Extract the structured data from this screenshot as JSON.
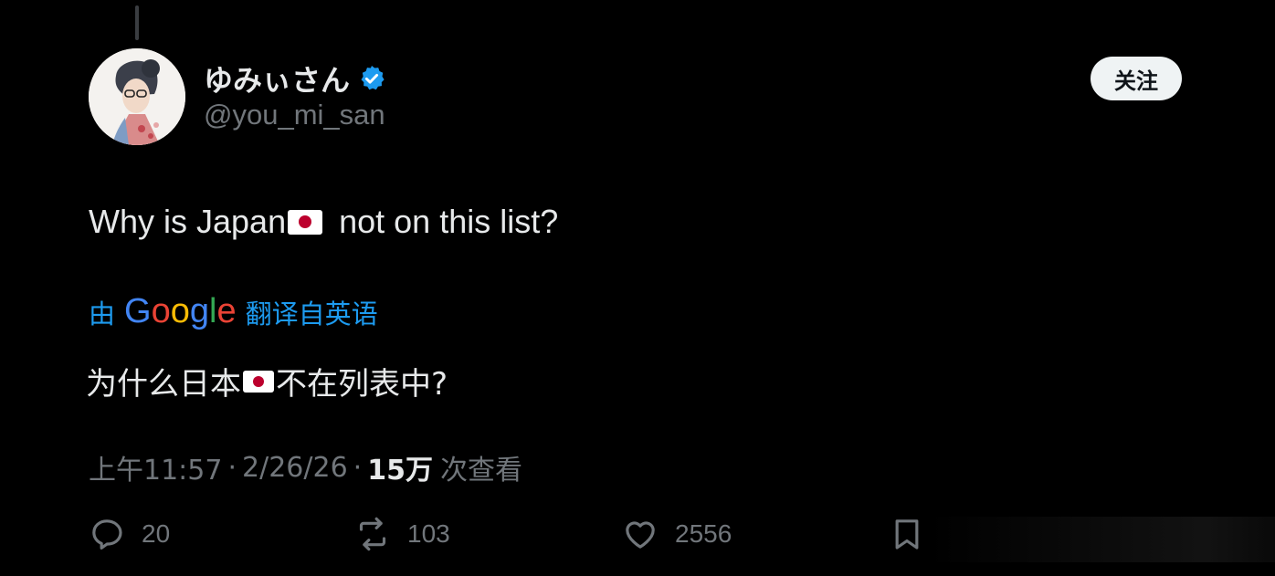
{
  "author": {
    "display_name": "ゆみぃさん",
    "handle": "@you_mi_san",
    "verified": true
  },
  "follow_button": {
    "label": "关注"
  },
  "tweet": {
    "text_before_flag": "Why is Japan",
    "text_after_flag": " not on this list?"
  },
  "translation": {
    "prefix": "由",
    "provider": "Google",
    "suffix": "翻译自英语",
    "text_before_flag": "为什么日本",
    "text_after_flag": "不在列表中?"
  },
  "meta": {
    "time": "上午11:57",
    "separator": "·",
    "date": "2/26/26",
    "views_count": "15万",
    "views_label": "次查看"
  },
  "actions": {
    "replies": "20",
    "reposts": "103",
    "likes": "2556"
  },
  "colors": {
    "background": "#000000",
    "text": "#e7e9ea",
    "muted": "#71767b",
    "accent": "#1d9bf0"
  },
  "icons": [
    "verified-badge-icon",
    "reply-icon",
    "repost-icon",
    "like-icon",
    "bookmark-icon",
    "japan-flag-icon"
  ]
}
